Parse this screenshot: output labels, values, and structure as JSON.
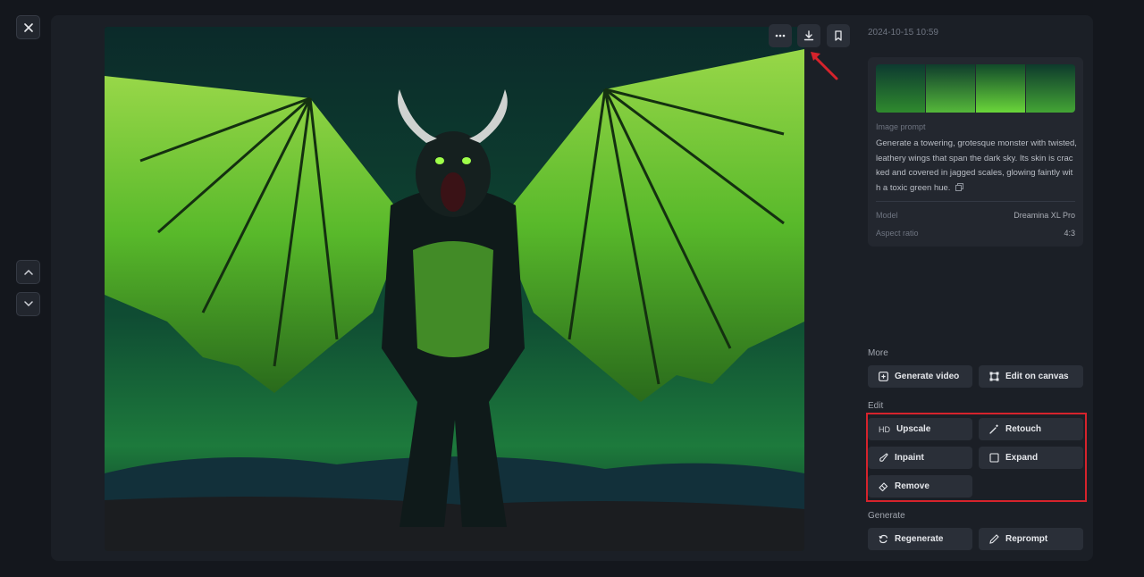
{
  "nav": {
    "close_icon": "close-icon",
    "prev_icon": "chevron-up-icon",
    "next_icon": "chevron-down-icon"
  },
  "image_toolbar": {
    "more_icon": "more-dots-icon",
    "download_icon": "download-icon",
    "bookmark_icon": "bookmark-icon"
  },
  "info": {
    "timestamp": "2024-10-15 10:59",
    "prompt_label": "Image prompt",
    "prompt_text": "Generate a towering, grotesque monster with twisted, leathery wings that span the dark sky. Its skin is cracked and covered in jagged scales, glowing faintly with a toxic green hue.",
    "copy_icon": "copy-icon",
    "model_label": "Model",
    "model_value": "Dreamina XL Pro",
    "aspect_label": "Aspect ratio",
    "aspect_value": "4:3"
  },
  "sections": {
    "more": {
      "title": "More",
      "generate_video": "Generate video",
      "edit_on_canvas": "Edit on canvas"
    },
    "edit": {
      "title": "Edit",
      "hd_glyph": "HD",
      "upscale": "Upscale",
      "retouch": "Retouch",
      "inpaint": "Inpaint",
      "expand": "Expand",
      "remove": "Remove"
    },
    "generate": {
      "title": "Generate",
      "regenerate": "Regenerate",
      "reprompt": "Reprompt"
    }
  },
  "colors": {
    "annotation_red": "#d6232c",
    "panel_bg": "#1b1f26",
    "button_bg": "#2a2f38"
  }
}
